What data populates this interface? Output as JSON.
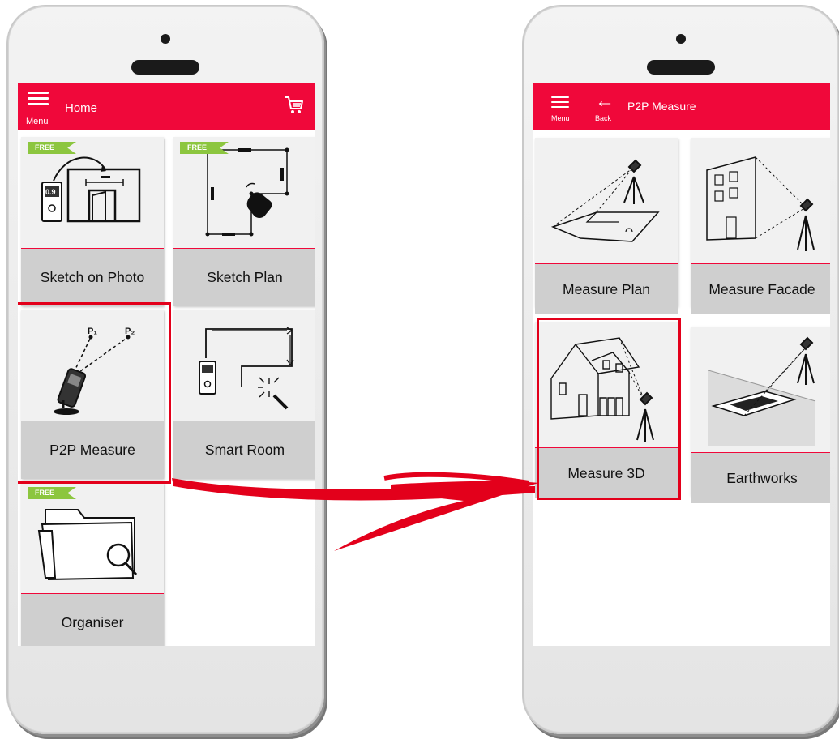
{
  "left_screen": {
    "appbar": {
      "menu_label": "Menu",
      "title": "Home"
    },
    "tiles": [
      {
        "label": "Sketch on Photo",
        "badge": "FREE"
      },
      {
        "label": "Sketch Plan",
        "badge": "FREE"
      },
      {
        "label": "P2P Measure",
        "art_p1": "P₁",
        "art_p2": "P₂"
      },
      {
        "label": "Smart Room"
      },
      {
        "label": "Organiser",
        "badge": "FREE"
      }
    ]
  },
  "right_screen": {
    "appbar": {
      "menu_label": "Menu",
      "back_label": "Back",
      "title": "P2P Measure"
    },
    "tiles": [
      {
        "label": "Measure Plan"
      },
      {
        "label": "Measure Facade"
      },
      {
        "label": "Measure 3D"
      },
      {
        "label": "Earthworks"
      }
    ]
  },
  "colors": {
    "brand_red": "#f0083a",
    "highlight_red": "#e3001b",
    "free_green": "#8cc63f"
  },
  "icons": [
    "menu-icon",
    "cart-icon",
    "back-arrow-icon"
  ]
}
